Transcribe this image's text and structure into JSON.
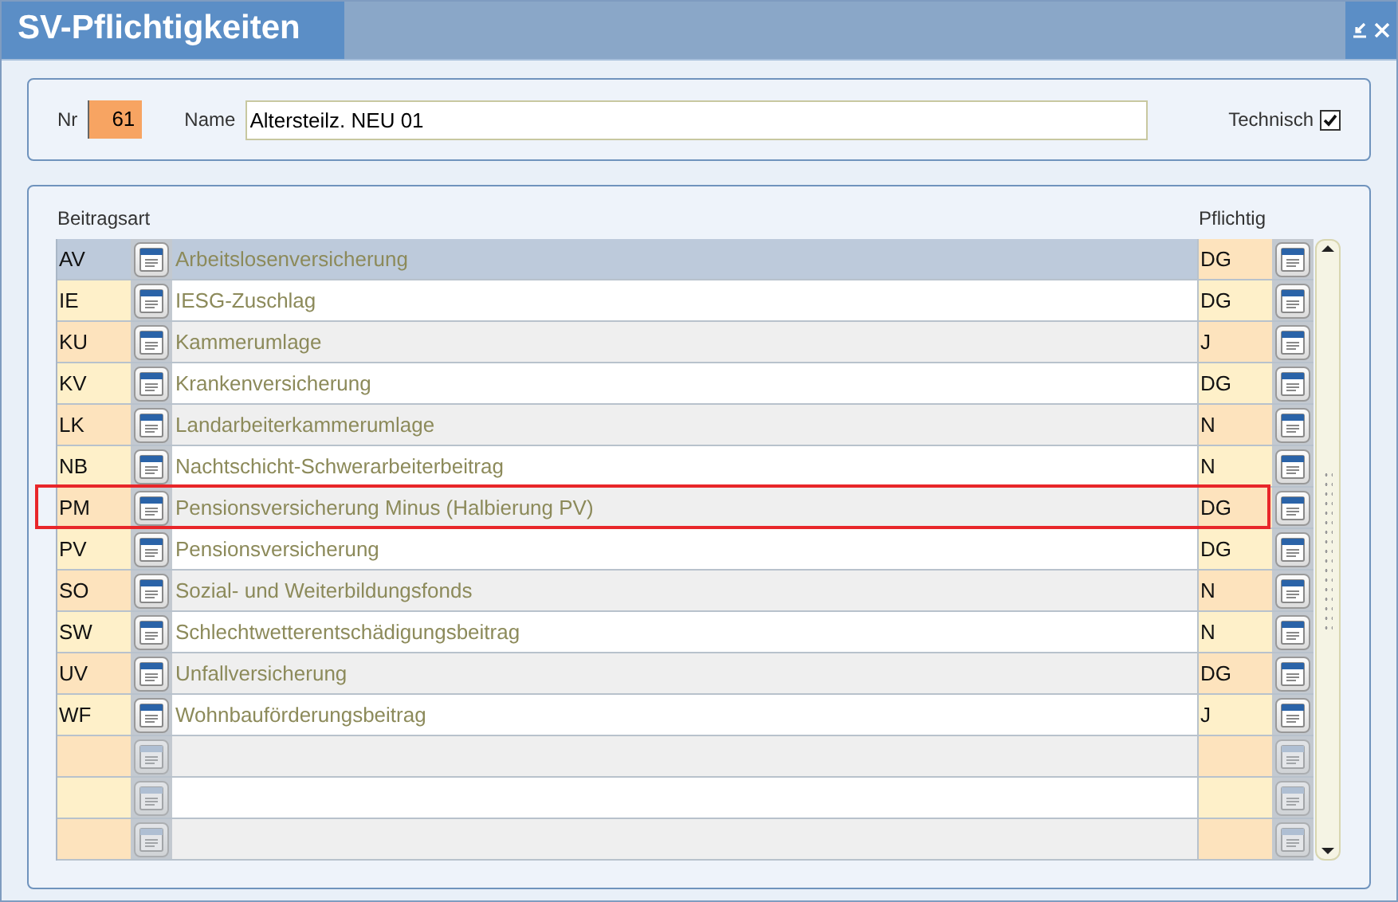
{
  "window": {
    "title": "SV-Pflichtigkeiten"
  },
  "header": {
    "nr_label": "Nr",
    "nr": "61",
    "name_label": "Name",
    "name": "Altersteilz. NEU 01",
    "technisch_label": "Technisch",
    "technisch_checked": true
  },
  "table": {
    "columns": [
      "Beitragsart",
      "Pflichtig"
    ],
    "rows": [
      {
        "kind": "entry",
        "code": "AV",
        "name": "Arbeitslosenversicherung",
        "pflichtig": "DG",
        "selected": true,
        "marked": false
      },
      {
        "kind": "entry",
        "code": "IE",
        "name": "IESG-Zuschlag",
        "pflichtig": "DG",
        "selected": false,
        "marked": false
      },
      {
        "kind": "entry",
        "code": "KU",
        "name": "Kammerumlage",
        "pflichtig": "J",
        "selected": false,
        "marked": false
      },
      {
        "kind": "entry",
        "code": "KV",
        "name": "Krankenversicherung",
        "pflichtig": "DG",
        "selected": false,
        "marked": false
      },
      {
        "kind": "entry",
        "code": "LK",
        "name": "Landarbeiterkammerumlage",
        "pflichtig": "N",
        "selected": false,
        "marked": false
      },
      {
        "kind": "entry",
        "code": "NB",
        "name": "Nachtschicht-Schwerarbeiterbeitrag",
        "pflichtig": "N",
        "selected": false,
        "marked": false
      },
      {
        "kind": "entry",
        "code": "PM",
        "name": "Pensionsversicherung Minus (Halbierung PV)",
        "pflichtig": "DG",
        "selected": false,
        "marked": true
      },
      {
        "kind": "entry",
        "code": "PV",
        "name": "Pensionsversicherung",
        "pflichtig": "DG",
        "selected": false,
        "marked": false
      },
      {
        "kind": "entry",
        "code": "SO",
        "name": "Sozial- und Weiterbildungsfonds",
        "pflichtig": "N",
        "selected": false,
        "marked": false
      },
      {
        "kind": "entry",
        "code": "SW",
        "name": "Schlechtwetterentschädigungsbeitrag",
        "pflichtig": "N",
        "selected": false,
        "marked": false
      },
      {
        "kind": "entry",
        "code": "UV",
        "name": "Unfallversicherung",
        "pflichtig": "DG",
        "selected": false,
        "marked": false
      },
      {
        "kind": "entry",
        "code": "WF",
        "name": "Wohnbauförderungsbeitrag",
        "pflichtig": "J",
        "selected": false,
        "marked": false
      },
      {
        "kind": "empty"
      },
      {
        "kind": "empty"
      },
      {
        "kind": "empty"
      }
    ]
  }
}
